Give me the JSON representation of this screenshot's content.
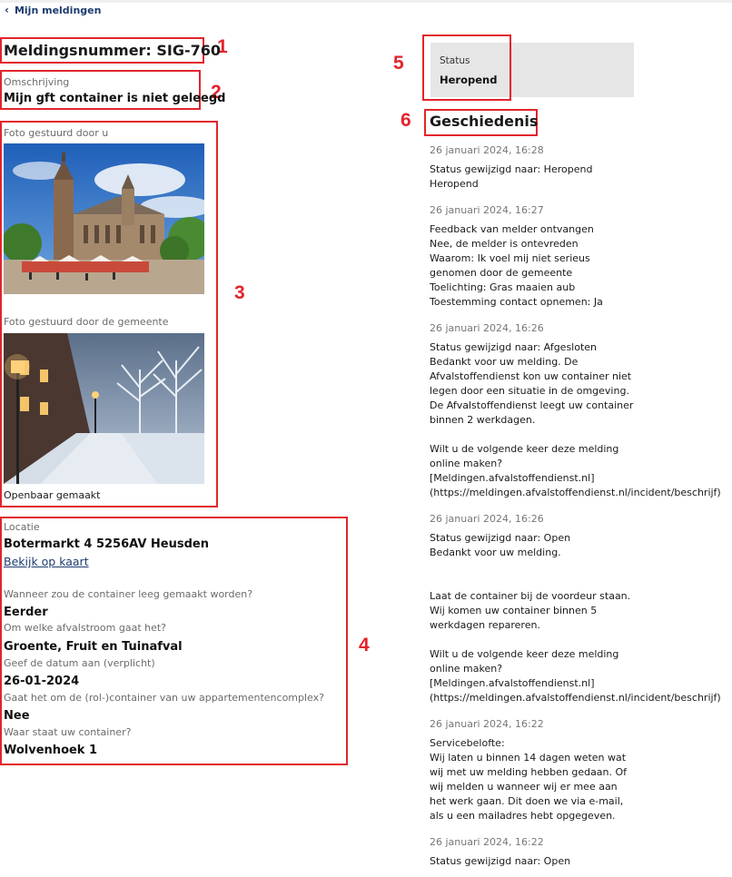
{
  "nav": {
    "back_label": "Mijn meldingen"
  },
  "annotations": [
    "1",
    "2",
    "3",
    "4",
    "5",
    "6"
  ],
  "melding": {
    "number_text": "Meldingsnummer: SIG-760",
    "description_label": "Omschrijving",
    "description_value": "Mijn gft container is niet geleegd"
  },
  "photos": {
    "user_label": "Foto gestuurd door u",
    "municipality_label": "Foto gestuurd door de gemeente",
    "public_label": "Openbaar gemaakt"
  },
  "location": {
    "label": "Locatie",
    "address": "Botermarkt 4 5256AV Heusden",
    "map_link": "Bekijk op kaart"
  },
  "questions": [
    {
      "q": "Wanneer zou de container leeg gemaakt worden?",
      "a": "Eerder"
    },
    {
      "q": "Om welke afvalstroom gaat het?",
      "a": "Groente, Fruit en Tuinafval"
    },
    {
      "q": "Geef de datum aan (verplicht)",
      "a": "26-01-2024"
    },
    {
      "q": "Gaat het om de (rol-)container van uw appartementencomplex?",
      "a": "Nee"
    },
    {
      "q": "Waar staat uw container?",
      "a": "Wolvenhoek 1"
    }
  ],
  "status": {
    "label": "Status",
    "value": "Heropend"
  },
  "history": {
    "title": "Geschiedenis",
    "entries": [
      {
        "date": "26 januari 2024, 16:28",
        "lines": [
          "Status gewijzigd naar: Heropend",
          "Heropend"
        ]
      },
      {
        "date": "26 januari 2024, 16:27",
        "lines": [
          "Feedback van melder ontvangen",
          "Nee, de melder is ontevreden",
          "Waarom: Ik voel mij niet serieus",
          "genomen door de gemeente",
          "Toelichting: Gras maaien aub",
          "Toestemming contact opnemen: Ja"
        ]
      },
      {
        "date": "26 januari 2024, 16:26",
        "lines": [
          "Status gewijzigd naar: Afgesloten",
          "Bedankt voor uw melding. De",
          "Afvalstoffendienst kon uw container niet",
          "legen door een situatie in de omgeving.",
          "De Afvalstoffendienst leegt uw container",
          "binnen 2 werkdagen.",
          "",
          "Wilt u de volgende keer deze melding",
          "online maken?",
          "[Meldingen.afvalstoffendienst.nl]",
          "(https://meldingen.afvalstoffendienst.nl/incident/beschrijf)"
        ]
      },
      {
        "date": "26 januari 2024, 16:26",
        "lines": [
          "Status gewijzigd naar: Open",
          "Bedankt voor uw melding.",
          "",
          "",
          "Laat de container bij de voordeur staan.",
          "Wij komen uw container binnen 5",
          "werkdagen repareren.",
          "",
          "Wilt u de volgende keer deze melding",
          "online maken?",
          "[Meldingen.afvalstoffendienst.nl]",
          "(https://meldingen.afvalstoffendienst.nl/incident/beschrijf)"
        ]
      },
      {
        "date": "26 januari 2024, 16:22",
        "lines": [
          "Servicebelofte:",
          "Wij laten u binnen 14 dagen weten wat",
          "wij met uw melding hebben gedaan. Of",
          "wij melden u wanneer wij er mee aan",
          "het werk gaan. Dit doen we via e-mail,",
          "als u een mailadres hebt opgegeven."
        ]
      },
      {
        "date": "26 januari 2024, 16:22",
        "lines": [
          "Status gewijzigd naar: Open"
        ]
      }
    ]
  }
}
